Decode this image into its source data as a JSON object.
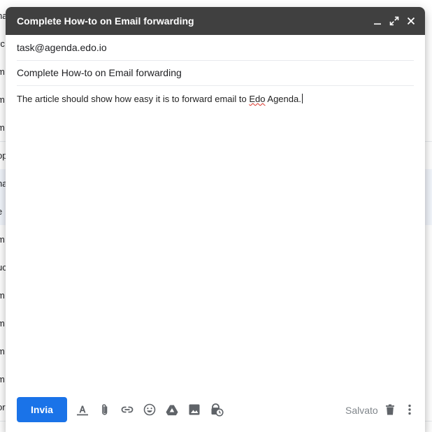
{
  "background_list": {
    "rows": [
      "na",
      "rc",
      "m",
      "m",
      "op",
      "na",
      "e",
      "m",
      "uc",
      "m",
      "m",
      "m",
      "m",
      "m",
      "or"
    ]
  },
  "compose": {
    "title": "Complete How-to on Email forwarding",
    "to": "task@agenda.edo.io",
    "subject": "Complete How-to on Email forwarding",
    "body_before": "The article should show how easy it is to forward email to ",
    "body_misspelled": "Edo",
    "body_after": " Agenda.",
    "send_label": "Invia",
    "saved_label": "Salvato",
    "window_controls": [
      "minimize-icon",
      "expand-icon",
      "close-icon"
    ],
    "toolbar_icons": [
      "format-text-icon",
      "attach-icon",
      "link-icon",
      "emoji-icon",
      "drive-icon",
      "image-icon",
      "confidential-icon"
    ],
    "end_icons": [
      "trash-icon",
      "more-vert-icon"
    ]
  },
  "colors": {
    "titlebar": "#404040",
    "send_button": "#1a73e8",
    "icon": "#5f6368"
  }
}
